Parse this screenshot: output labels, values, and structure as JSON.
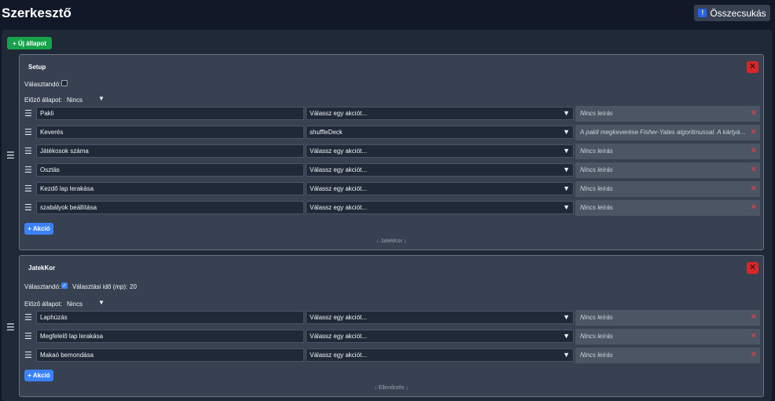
{
  "header": {
    "title": "Szerkesztő",
    "collapse_label": "Összecsukás",
    "collapse_icon": "!"
  },
  "toolbar": {
    "add_state_label": "+ Új állapot"
  },
  "labels": {
    "selectable": "Választandó:",
    "previous_state": "Előző állapot:",
    "choice_time": "Választási idő (mp):",
    "add_action": "+ Akció"
  },
  "states": [
    {
      "name": "Setup",
      "selectable": false,
      "previous": "Nincs",
      "next_label": "↓ JatekKor ↓",
      "actions": [
        {
          "name": "Pakli",
          "action": "Válassz egy akciót...",
          "desc": "Nincs leírás"
        },
        {
          "name": "Keverés",
          "action": "shuffleDeck",
          "desc": "A pakli megkeverése Fisher-Yates algoritmussal. A kártyák s..."
        },
        {
          "name": "Játékosok száma",
          "action": "Válassz egy akciót...",
          "desc": "Nincs leírás"
        },
        {
          "name": "Osztás",
          "action": "Válassz egy akciót...",
          "desc": "Nincs leírás"
        },
        {
          "name": "Kezdő lap lerakása",
          "action": "Válassz egy akciót...",
          "desc": "Nincs leírás"
        },
        {
          "name": "szabályok beállítása",
          "action": "Válassz egy akciót...",
          "desc": "Nincs leírás"
        }
      ]
    },
    {
      "name": "JatekKor",
      "selectable": true,
      "choice_time": "20",
      "previous": "Nincs",
      "next_label": "↓ Ellenőrzés ↓",
      "actions": [
        {
          "name": "Laphúzás",
          "action": "Válassz egy akciót...",
          "desc": "Nincs leírás"
        },
        {
          "name": "Megfelelő lap lerakása",
          "action": "Válassz egy akciót...",
          "desc": "Nincs leírás"
        },
        {
          "name": "Makaó bemondása",
          "action": "Válassz egy akciót...",
          "desc": "Nincs leírás"
        }
      ]
    }
  ]
}
